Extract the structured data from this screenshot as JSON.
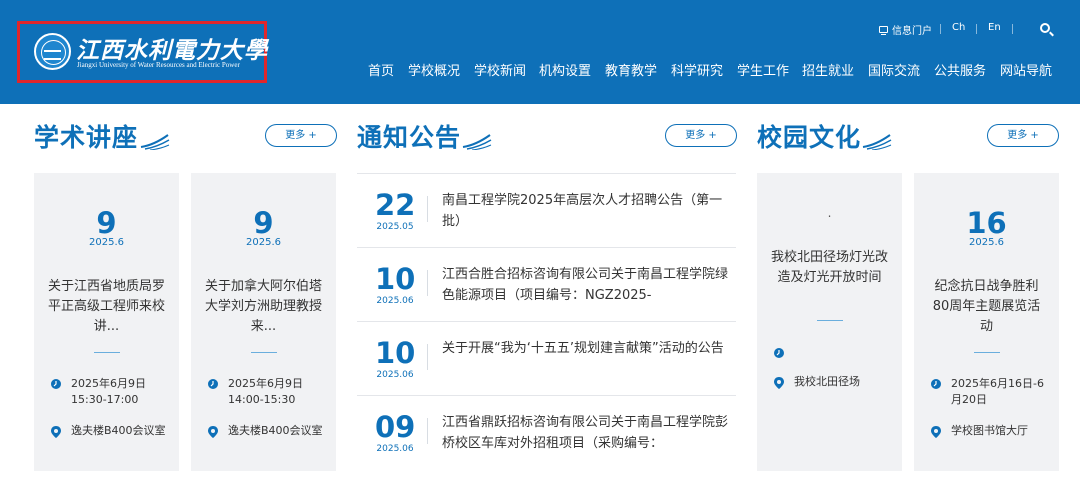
{
  "header": {
    "logo": {
      "name_cn": "江西水利電力大學",
      "name_en": "Jiangxi University of Water Resources and Electric Power"
    },
    "top_links": {
      "info_portal": "信息门户",
      "chinese": "Ch",
      "english": "En",
      "search_icon": "search-icon"
    },
    "nav": [
      "首页",
      "学校概况",
      "学校新闻",
      "机构设置",
      "教育教学",
      "科学研究",
      "学生工作",
      "招生就业",
      "国际交流",
      "公共服务",
      "网站导航"
    ]
  },
  "sections": {
    "lectures": {
      "title": "学术讲座",
      "more": "更多 +",
      "cards": [
        {
          "day": "9",
          "ym": "2025.6",
          "title": "关于江西省地质局罗平正高级工程师来校讲...",
          "time": "2025年6月9日 15:30-17:00",
          "place": "逸夫楼B400会议室"
        },
        {
          "day": "9",
          "ym": "2025.6",
          "title": "关于加拿大阿尔伯塔大学刘方洲助理教授来...",
          "time": "2025年6月9日 14:00-15:30",
          "place": "逸夫楼B400会议室"
        }
      ]
    },
    "notices": {
      "title": "通知公告",
      "more": "更多 +",
      "items": [
        {
          "day": "22",
          "ym": "2025.05",
          "title": "南昌工程学院2025年高层次人才招聘公告（第一批）"
        },
        {
          "day": "10",
          "ym": "2025.06",
          "title": "江西合胜合招标咨询有限公司关于南昌工程学院绿色能源项目（项目编号：NGZ2025-"
        },
        {
          "day": "10",
          "ym": "2025.06",
          "title": "关于开展“我为‘十五五’规划建言献策”活动的公告"
        },
        {
          "day": "09",
          "ym": "2025.06",
          "title": "江西省鼎跃招标咨询有限公司关于南昌工程学院彭桥校区车库对外招租项目（采购编号："
        }
      ]
    },
    "culture": {
      "title": "校园文化",
      "more": "更多 +",
      "cards": [
        {
          "day": ".",
          "ym": "",
          "title": "我校北田径场灯光改造及灯光开放时间",
          "time": "",
          "place": "我校北田径场"
        },
        {
          "day": "16",
          "ym": "2025.6",
          "title": "纪念抗日战争胜利80周年主题展览活动",
          "time": "2025年6月16日-6月20日",
          "place": "学校图书馆大厅"
        }
      ]
    }
  },
  "colors": {
    "brand_blue": "#0e70b8",
    "logo_highlight_red": "#e0262b",
    "card_bg": "#f1f2f4"
  }
}
